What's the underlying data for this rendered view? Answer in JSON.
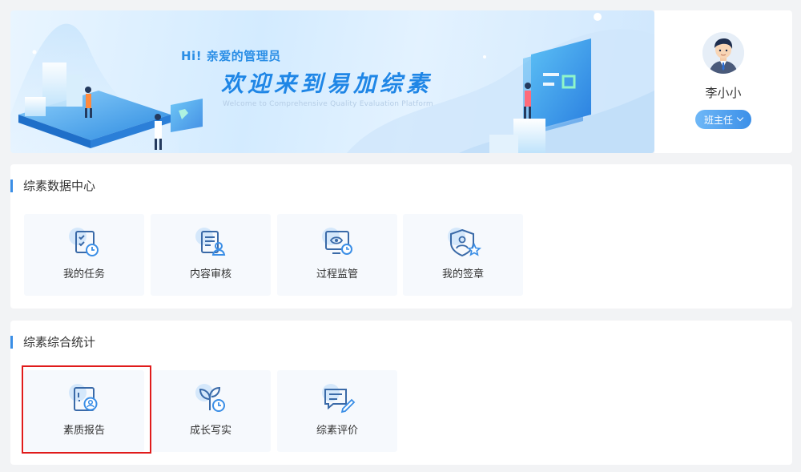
{
  "banner": {
    "greeting": "Hi! 亲爱的管理员",
    "welcome": "欢迎来到易加综素",
    "welcome_en": "Welcome to Comprehensive Quality Evaluation Platform"
  },
  "user": {
    "name": "李小小",
    "role": "班主任"
  },
  "data_center": {
    "title": "综素数据中心",
    "items": [
      {
        "label": "我的任务",
        "icon": "task-clipboard-icon"
      },
      {
        "label": "内容审核",
        "icon": "content-review-icon"
      },
      {
        "label": "过程监管",
        "icon": "process-monitor-icon"
      },
      {
        "label": "我的签章",
        "icon": "signature-seal-icon"
      }
    ]
  },
  "statistics": {
    "title": "综素综合统计",
    "items": [
      {
        "label": "素质报告",
        "icon": "quality-report-icon"
      },
      {
        "label": "成长写实",
        "icon": "growth-record-icon"
      },
      {
        "label": "综素评价",
        "icon": "evaluation-comment-icon"
      }
    ]
  },
  "colors": {
    "accent": "#3a8ee6",
    "tile_bg": "#f6f9fd",
    "highlight": "#e01b1b"
  }
}
